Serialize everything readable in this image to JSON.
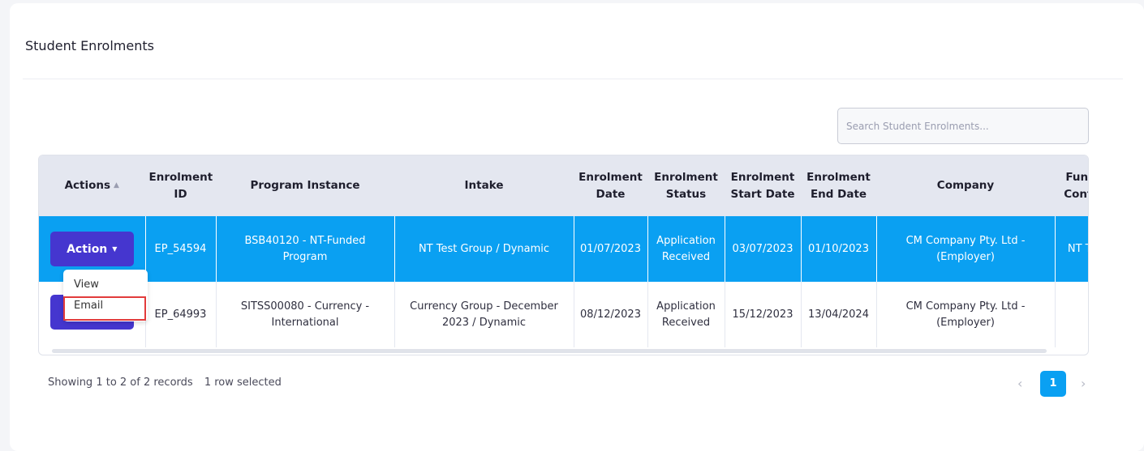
{
  "card": {
    "title": "Student Enrolments"
  },
  "search": {
    "placeholder": "Search Student Enrolments..."
  },
  "table": {
    "columns": [
      "Actions",
      "Enrolment ID",
      "Program Instance",
      "Intake",
      "Enrolment Date",
      "Enrolment Status",
      "Enrolment Start Date",
      "Enrolment End Date",
      "Company",
      "Funding Contract"
    ],
    "rows": [
      {
        "action_label": "Action",
        "enrolment_id": "EP_54594",
        "program_instance": "BSB40120 - NT-Funded Program",
        "intake": "NT Test Group / Dynamic",
        "enrolment_date": "01/07/2023",
        "enrolment_status": "Application Received",
        "start_date": "03/07/2023",
        "end_date": "01/10/2023",
        "company": "CM Company Pty. Ltd - (Employer)",
        "funding_contract": "NT T Cont"
      },
      {
        "enrolment_id": "EP_64993",
        "program_instance": "SITSS00080 - Currency - International",
        "intake": "Currency Group - December 2023 / Dynamic",
        "enrolment_date": "08/12/2023",
        "enrolment_status": "Application Received",
        "start_date": "15/12/2023",
        "end_date": "13/04/2024",
        "company": "CM Company Pty. Ltd - (Employer)",
        "funding_contract": ""
      }
    ]
  },
  "dropdown": {
    "items": [
      "View",
      "Email"
    ]
  },
  "footer": {
    "showing": "Showing 1 to 2 of 2 records",
    "selected": "1 row selected"
  },
  "pagination": {
    "prev": "‹",
    "current": "1",
    "next": "›"
  },
  "colors": {
    "accent": "#0aa0f2",
    "action": "#4536cf",
    "highlight": "#e23b3b"
  }
}
